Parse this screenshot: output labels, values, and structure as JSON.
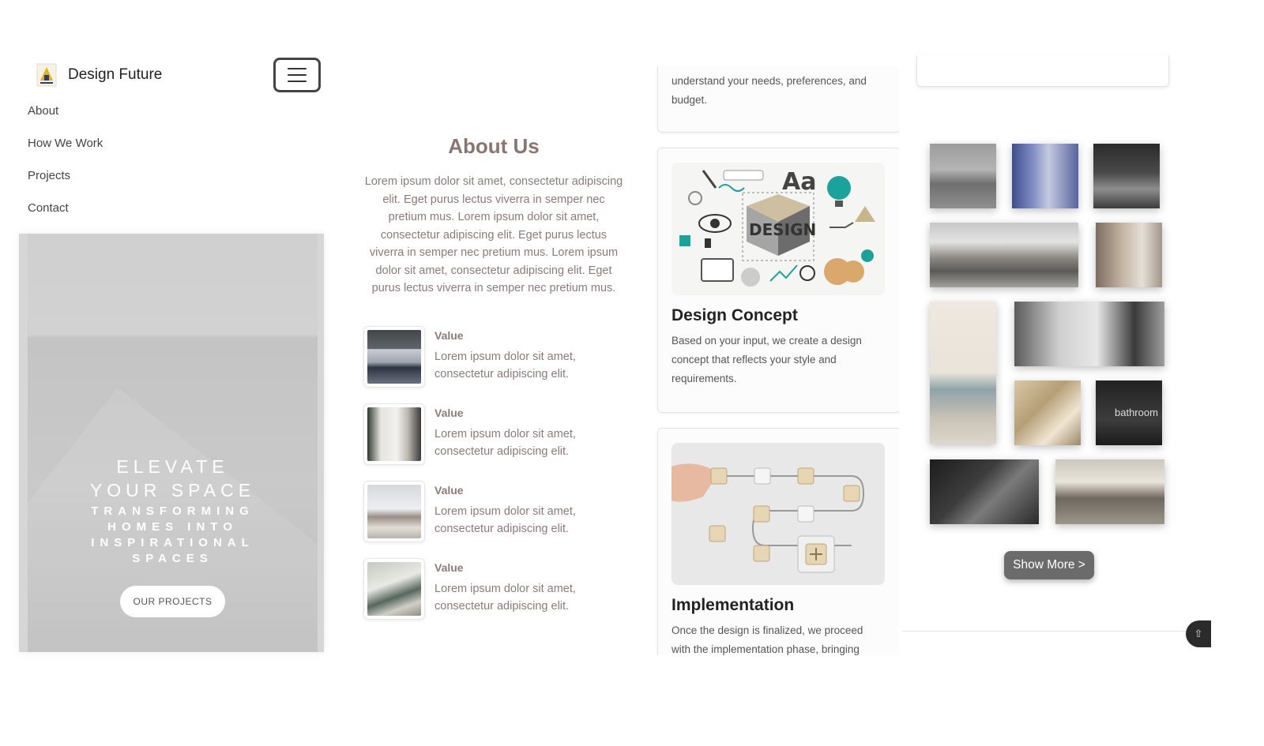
{
  "brand": {
    "name": "Design Future",
    "logo_icon": "house-logo-icon"
  },
  "menu_button_icon": "hamburger-menu-icon",
  "nav": {
    "items": [
      "About",
      "How We Work",
      "Projects",
      "Contact"
    ]
  },
  "hero": {
    "title_line1": "ELEVATE",
    "title_line2": "YOUR SPACE",
    "subtitle": "TRANSFORMING HOMES INTO INSPIRATIONAL SPACES",
    "cta_label": "OUR PROJECTS"
  },
  "about": {
    "title": "About Us",
    "text": "Lorem ipsum dolor sit amet, consectetur adipiscing elit. Eget purus lectus viverra in semper nec pretium mus. Lorem ipsum dolor sit amet, consectetur adipiscing elit. Eget purus lectus viverra in semper nec pretium mus. Lorem ipsum dolor sit amet, consectetur adipiscing elit. Eget purus lectus viverra in semper nec pretium mus.",
    "values": [
      {
        "title": "Value",
        "desc": "Lorem ipsum dolor sit amet, consectetur adipiscing elit."
      },
      {
        "title": "Value",
        "desc": "Lorem ipsum dolor sit amet, consectetur adipiscing elit."
      },
      {
        "title": "Value",
        "desc": "Lorem ipsum dolor sit amet, consectetur adipiscing elit."
      },
      {
        "title": "Value",
        "desc": "Lorem ipsum dolor sit amet, consectetur adipiscing elit."
      }
    ]
  },
  "process": {
    "consultation_tail": "understand your needs, preferences, and budget.",
    "design_concept": {
      "title": "Design Concept",
      "desc": "Based on your input, we create a design concept that reflects your style and requirements.",
      "image_word": "DESIGN",
      "image_glyph": "Aa"
    },
    "implementation": {
      "title": "Implementation",
      "desc": "Once the design is finalized, we proceed with the implementation phase, bringing"
    }
  },
  "gallery": {
    "bathroom_label": "bathroom",
    "show_more_label": "Show More >",
    "scroll_top_icon": "⇧"
  },
  "colors": {
    "accent_text": "#8a7570",
    "button_dark": "#6b6b6b"
  }
}
